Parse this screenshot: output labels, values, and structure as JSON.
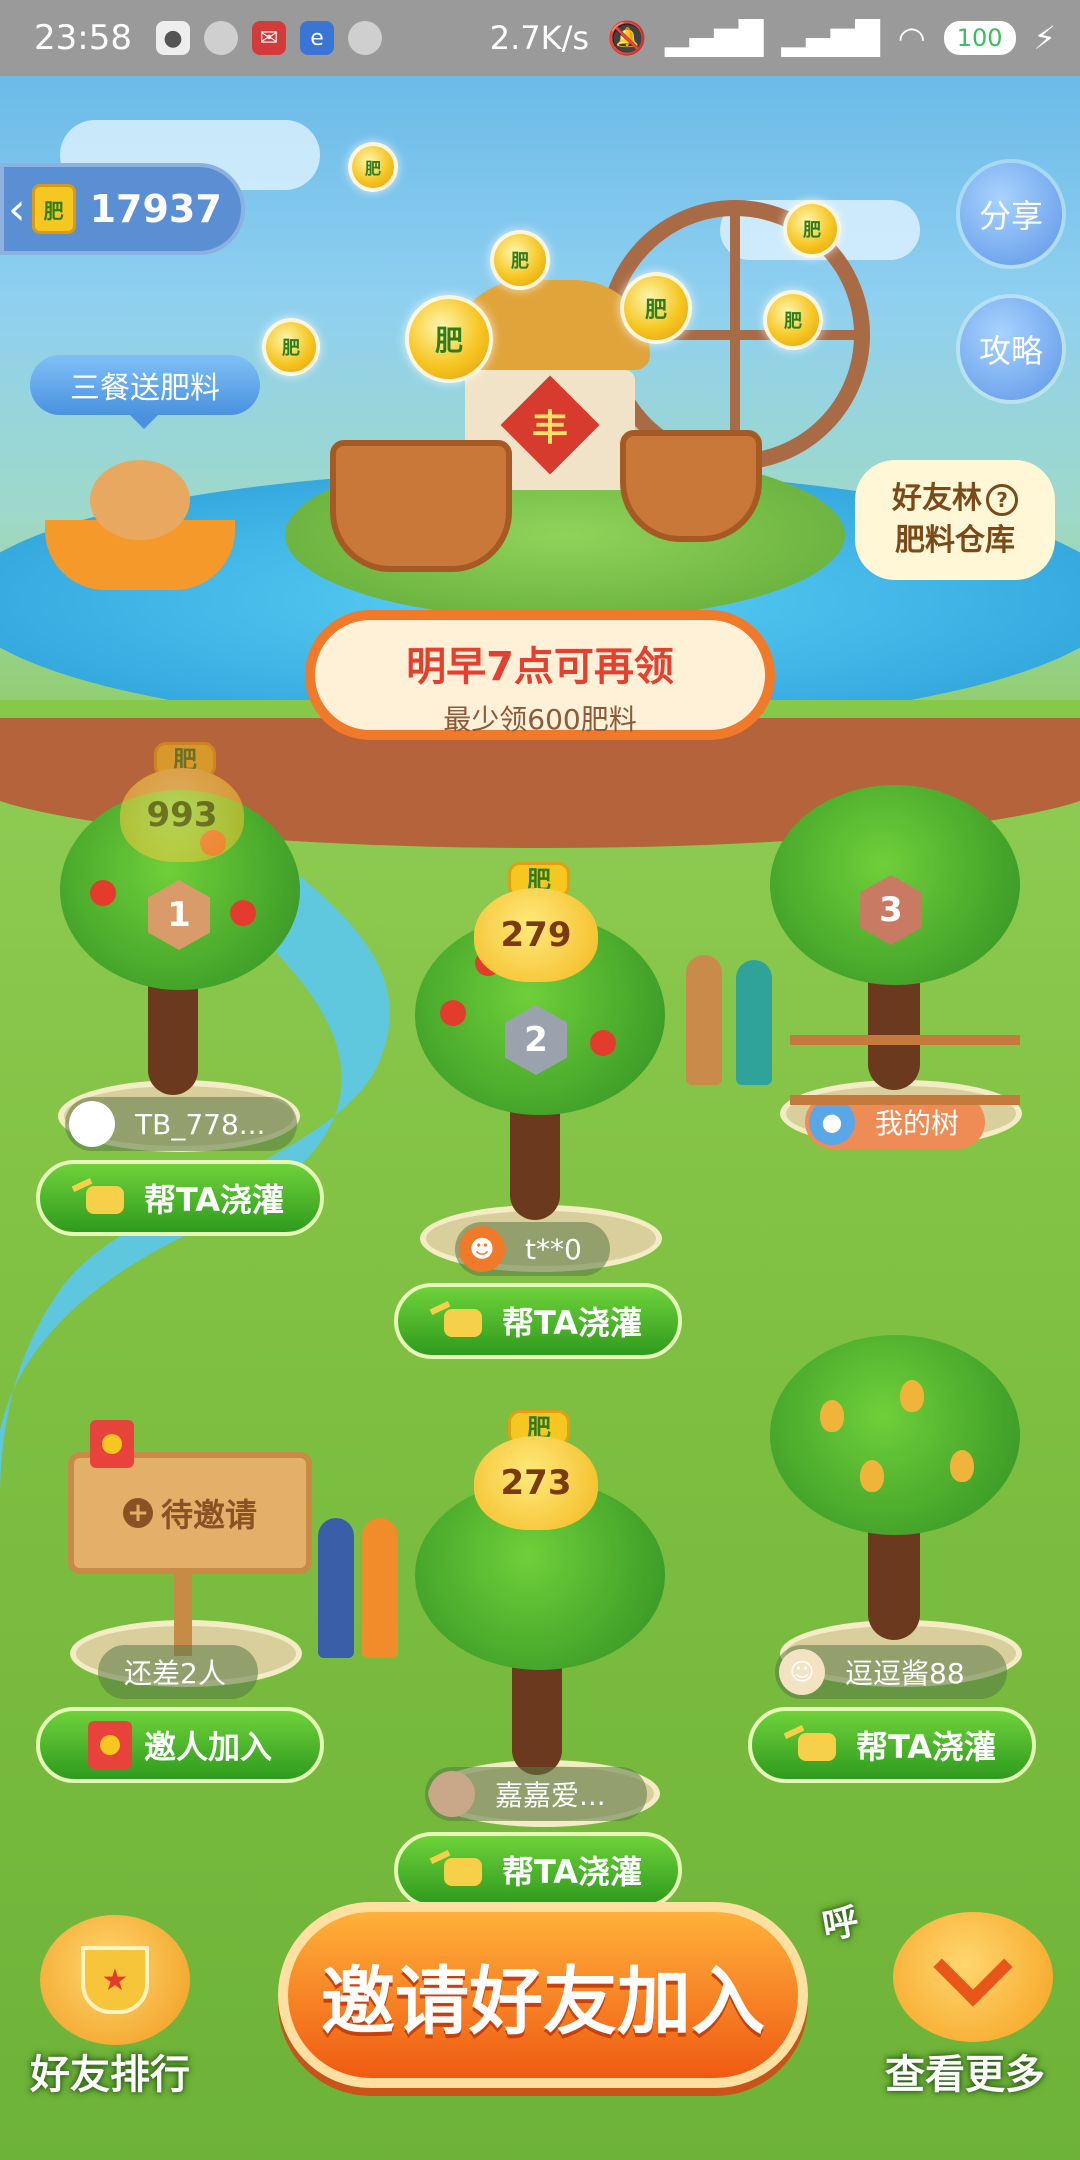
{
  "status_bar": {
    "time": "23:58",
    "net_speed": "2.7K/s",
    "battery": "100",
    "notif_icons": [
      "wechat-icon",
      "circle-icon",
      "post-icon",
      "browser-icon",
      "circle-icon"
    ]
  },
  "header": {
    "balance": "17937",
    "share_label": "分享",
    "guide_label": "攻略",
    "meal_tip": "三餐送肥料",
    "warehouse_line1": "好友林",
    "warehouse_help": "?",
    "warehouse_line2": "肥料仓库"
  },
  "scene": {
    "hut_sign": "丰",
    "fertilizer_label": "肥"
  },
  "notice": {
    "title": "明早7点可再领",
    "subtitle": "最少领600肥料"
  },
  "trees": {
    "t1": {
      "rank": "1",
      "pot": "993",
      "name": "TB_778...",
      "button": "帮TA浇灌"
    },
    "t2": {
      "rank": "2",
      "pot": "279",
      "name": "t**0",
      "button": "帮TA浇灌"
    },
    "t3": {
      "rank": "3",
      "name": "我的树"
    },
    "t4": {
      "sign": "待邀请",
      "plus": "+",
      "need": "还差2人",
      "button": "邀人加入"
    },
    "t5": {
      "pot": "273",
      "name": "嘉嘉爱...",
      "button": "帮TA浇灌"
    },
    "t6": {
      "name": "逗逗酱88",
      "button": "帮TA浇灌"
    }
  },
  "bottom": {
    "rank_label": "好友排行",
    "invite_label": "邀请好友加入",
    "more_label": "查看更多",
    "sticker": "呼"
  },
  "colors": {
    "accent_orange": "#ef5a12",
    "button_green": "#2f9b1e",
    "notice_red": "#e43f2f",
    "balance_blue": "#5b8fd3"
  }
}
